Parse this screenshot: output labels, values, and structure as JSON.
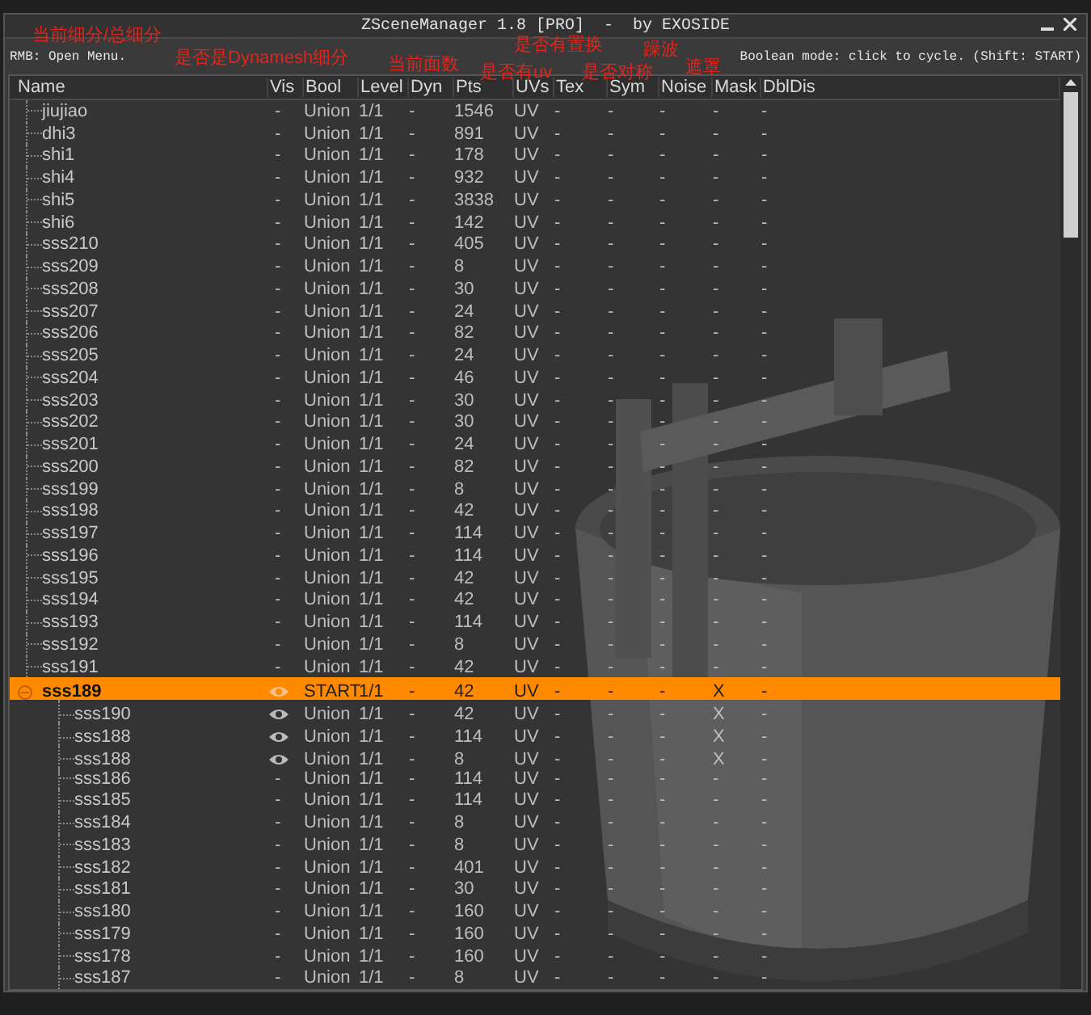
{
  "window": {
    "title": "ZSceneManager 1.8 [PRO]  -  by EXOSIDE"
  },
  "info": {
    "left": "RMB: Open Menu.",
    "right": "Boolean mode: click to cycle. (Shift: START)"
  },
  "annotations": [
    {
      "text": "当前细分/总细分"
    },
    {
      "text": "是否是Dynamesh细分"
    },
    {
      "text": "当前面数"
    },
    {
      "text": "是否有置换"
    },
    {
      "text": "是否有uv"
    },
    {
      "text": "是否对称"
    },
    {
      "text": "躁波"
    },
    {
      "text": "遮罩"
    }
  ],
  "table": {
    "columns": [
      "Name",
      "Vis",
      "Bool",
      "Level",
      "Dyn",
      "Pts",
      "UVs",
      "Tex",
      "Sym",
      "Noise",
      "Mask",
      "DblDis"
    ],
    "rows": [
      {
        "selected": false,
        "cells": [
          "jiujiao",
          "-",
          "Union",
          "1/1",
          "-",
          "1546",
          "UV",
          "-",
          "-",
          "-",
          "-",
          "-"
        ]
      },
      {
        "selected": false,
        "cells": [
          "dhi3",
          "-",
          "Union",
          "1/1",
          "-",
          "891",
          "UV",
          "-",
          "-",
          "-",
          "-",
          "-"
        ]
      },
      {
        "selected": false,
        "cells": [
          "shi1",
          "-",
          "Union",
          "1/1",
          "-",
          "178",
          "UV",
          "-",
          "-",
          "-",
          "-",
          "-"
        ]
      },
      {
        "selected": false,
        "cells": [
          "shi4",
          "-",
          "Union",
          "1/1",
          "-",
          "932",
          "UV",
          "-",
          "-",
          "-",
          "-",
          "-"
        ]
      },
      {
        "selected": false,
        "cells": [
          "shi5",
          "-",
          "Union",
          "1/1",
          "-",
          "3838",
          "UV",
          "-",
          "-",
          "-",
          "-",
          "-"
        ]
      },
      {
        "selected": false,
        "cells": [
          "shi6",
          "-",
          "Union",
          "1/1",
          "-",
          "142",
          "UV",
          "-",
          "-",
          "-",
          "-",
          "-"
        ]
      },
      {
        "selected": false,
        "cells": [
          "sss210",
          "-",
          "Union",
          "1/1",
          "-",
          "405",
          "UV",
          "-",
          "-",
          "-",
          "-",
          "-"
        ]
      },
      {
        "selected": false,
        "cells": [
          "sss209",
          "-",
          "Union",
          "1/1",
          "-",
          "8",
          "UV",
          "-",
          "-",
          "-",
          "-",
          "-"
        ]
      },
      {
        "selected": false,
        "cells": [
          "sss208",
          "-",
          "Union",
          "1/1",
          "-",
          "30",
          "UV",
          "-",
          "-",
          "-",
          "-",
          "-"
        ]
      },
      {
        "selected": false,
        "cells": [
          "sss207",
          "-",
          "Union",
          "1/1",
          "-",
          "24",
          "UV",
          "-",
          "-",
          "-",
          "-",
          "-"
        ]
      },
      {
        "selected": false,
        "cells": [
          "sss206",
          "-",
          "Union",
          "1/1",
          "-",
          "82",
          "UV",
          "-",
          "-",
          "-",
          "-",
          "-"
        ]
      },
      {
        "selected": false,
        "cells": [
          "sss205",
          "-",
          "Union",
          "1/1",
          "-",
          "24",
          "UV",
          "-",
          "-",
          "-",
          "-",
          "-"
        ]
      },
      {
        "selected": false,
        "cells": [
          "sss204",
          "-",
          "Union",
          "1/1",
          "-",
          "46",
          "UV",
          "-",
          "-",
          "-",
          "-",
          "-"
        ]
      },
      {
        "selected": false,
        "cells": [
          "sss203",
          "-",
          "Union",
          "1/1",
          "-",
          "30",
          "UV",
          "-",
          "-",
          "-",
          "-",
          "-"
        ]
      },
      {
        "selected": false,
        "cells": [
          "sss202",
          "-",
          "Union",
          "1/1",
          "-",
          "30",
          "UV",
          "-",
          "-",
          "-",
          "-",
          "-"
        ]
      },
      {
        "selected": false,
        "cells": [
          "sss201",
          "-",
          "Union",
          "1/1",
          "-",
          "24",
          "UV",
          "-",
          "-",
          "-",
          "-",
          "-"
        ]
      },
      {
        "selected": false,
        "cells": [
          "sss200",
          "-",
          "Union",
          "1/1",
          "-",
          "82",
          "UV",
          "-",
          "-",
          "-",
          "-",
          "-"
        ]
      },
      {
        "selected": false,
        "cells": [
          "sss199",
          "-",
          "Union",
          "1/1",
          "-",
          "8",
          "UV",
          "-",
          "-",
          "-",
          "-",
          "-"
        ]
      },
      {
        "selected": false,
        "cells": [
          "sss198",
          "-",
          "Union",
          "1/1",
          "-",
          "42",
          "UV",
          "-",
          "-",
          "-",
          "-",
          "-"
        ]
      },
      {
        "selected": false,
        "cells": [
          "sss197",
          "-",
          "Union",
          "1/1",
          "-",
          "114",
          "UV",
          "-",
          "-",
          "-",
          "-",
          "-"
        ]
      },
      {
        "selected": false,
        "cells": [
          "sss196",
          "-",
          "Union",
          "1/1",
          "-",
          "114",
          "UV",
          "-",
          "-",
          "-",
          "-",
          "-"
        ]
      },
      {
        "selected": false,
        "cells": [
          "sss195",
          "-",
          "Union",
          "1/1",
          "-",
          "42",
          "UV",
          "-",
          "-",
          "-",
          "-",
          "-"
        ]
      },
      {
        "selected": false,
        "cells": [
          "sss194",
          "-",
          "Union",
          "1/1",
          "-",
          "42",
          "UV",
          "-",
          "-",
          "-",
          "-",
          "-"
        ]
      },
      {
        "selected": false,
        "cells": [
          "sss193",
          "-",
          "Union",
          "1/1",
          "-",
          "114",
          "UV",
          "-",
          "-",
          "-",
          "-",
          "-"
        ]
      },
      {
        "selected": false,
        "cells": [
          "sss192",
          "-",
          "Union",
          "1/1",
          "-",
          "8",
          "UV",
          "-",
          "-",
          "-",
          "-",
          "-"
        ]
      },
      {
        "selected": false,
        "cells": [
          "sss191",
          "-",
          "Union",
          "1/1",
          "-",
          "42",
          "UV",
          "-",
          "-",
          "-",
          "-",
          "-"
        ]
      },
      {
        "visible": true,
        "selected": true,
        "expanded": true,
        "cells": [
          "sss189",
          "",
          "START",
          "1/1",
          "-",
          "42",
          "UV",
          "-",
          "-",
          "-",
          "X",
          "-"
        ],
        "children": [
          {
            "visible": true,
            "selected": false,
            "cells": [
              "sss190",
              "",
              "Union",
              "1/1",
              "-",
              "42",
              "UV",
              "-",
              "-",
              "-",
              "X",
              "-"
            ]
          },
          {
            "visible": true,
            "selected": false,
            "cells": [
              "sss188",
              "",
              "Union",
              "1/1",
              "-",
              "114",
              "UV",
              "-",
              "-",
              "-",
              "X",
              "-"
            ]
          },
          {
            "visible": true,
            "selected": false,
            "cells": [
              "sss188",
              "",
              "Union",
              "1/1",
              "-",
              "8",
              "UV",
              "-",
              "-",
              "-",
              "X",
              "-"
            ]
          },
          {
            "selected": false,
            "cells": [
              "sss186",
              "-",
              "Union",
              "1/1",
              "-",
              "114",
              "UV",
              "-",
              "-",
              "-",
              "-",
              "-"
            ]
          },
          {
            "selected": false,
            "cells": [
              "sss185",
              "-",
              "Union",
              "1/1",
              "-",
              "114",
              "UV",
              "-",
              "-",
              "-",
              "-",
              "-"
            ]
          },
          {
            "selected": false,
            "cells": [
              "sss184",
              "-",
              "Union",
              "1/1",
              "-",
              "8",
              "UV",
              "-",
              "-",
              "-",
              "-",
              "-"
            ]
          },
          {
            "selected": false,
            "cells": [
              "sss183",
              "-",
              "Union",
              "1/1",
              "-",
              "8",
              "UV",
              "-",
              "-",
              "-",
              "-",
              "-"
            ]
          },
          {
            "selected": false,
            "cells": [
              "sss182",
              "-",
              "Union",
              "1/1",
              "-",
              "401",
              "UV",
              "-",
              "-",
              "-",
              "-",
              "-"
            ]
          },
          {
            "selected": false,
            "cells": [
              "sss181",
              "-",
              "Union",
              "1/1",
              "-",
              "30",
              "UV",
              "-",
              "-",
              "-",
              "-",
              "-"
            ]
          },
          {
            "selected": false,
            "cells": [
              "sss180",
              "-",
              "Union",
              "1/1",
              "-",
              "160",
              "UV",
              "-",
              "-",
              "-",
              "-",
              "-"
            ]
          },
          {
            "selected": false,
            "cells": [
              "sss179",
              "-",
              "Union",
              "1/1",
              "-",
              "160",
              "UV",
              "-",
              "-",
              "-",
              "-",
              "-"
            ]
          },
          {
            "selected": false,
            "cells": [
              "sss178",
              "-",
              "Union",
              "1/1",
              "-",
              "160",
              "UV",
              "-",
              "-",
              "-",
              "-",
              "-"
            ]
          },
          {
            "selected": false,
            "cells": [
              "sss187",
              "-",
              "Union",
              "1/1",
              "-",
              "8",
              "UV",
              "-",
              "-",
              "-",
              "-",
              "-"
            ]
          }
        ]
      }
    ]
  }
}
